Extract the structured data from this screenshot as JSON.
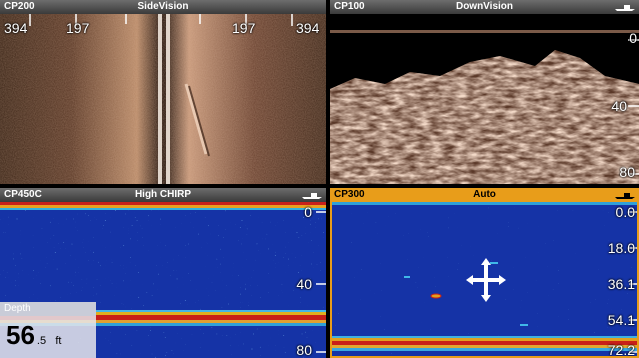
{
  "panes": {
    "top_left": {
      "transducer": "CP200",
      "mode": "SideVision",
      "scale": [
        "394",
        "197",
        "197",
        "394"
      ]
    },
    "top_right": {
      "transducer": "CP100",
      "mode": "DownVision",
      "scale": [
        "0",
        "40",
        "80"
      ]
    },
    "bottom_left": {
      "transducer": "CP450C",
      "mode": "High CHIRP",
      "scale": [
        "0",
        "40",
        "80"
      ]
    },
    "bottom_right": {
      "transducer": "CP300",
      "mode": "Auto",
      "scale": [
        "0.0",
        "18.0",
        "36.1",
        "54.1",
        "72.2"
      ]
    }
  },
  "depth": {
    "label": "Depth",
    "value": "56",
    "decimal": ".5",
    "unit": "ft"
  },
  "colors": {
    "header_gray": "#4a4a4a",
    "header_active": "#e89d1a",
    "sonar_blue": "#1533a6"
  },
  "icons": {
    "boat": "boat-icon",
    "cursor": "crosshair-cursor-icon"
  }
}
